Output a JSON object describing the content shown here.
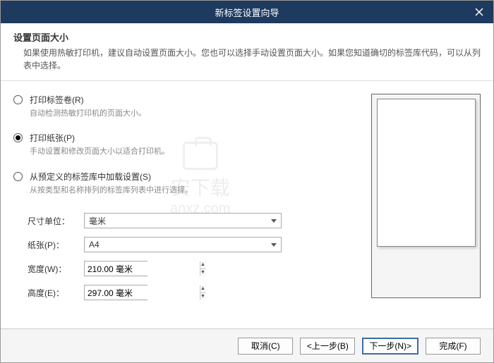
{
  "title": "新标签设置向导",
  "header": {
    "title": "设置页面大小",
    "desc": "如果使用热敏打印机，建议自动设置页面大小。您也可以选择手动设置页面大小。如果您知道确切的标签库代码，可以从列表中选择。"
  },
  "options": {
    "roll": {
      "label": "打印标签卷(R)",
      "desc": "自动检测热敏打印机的页面大小。"
    },
    "paper": {
      "label": "打印纸张(P)",
      "desc": "手动设置和修改页面大小以适合打印机。"
    },
    "predef": {
      "label": "从预定义的标签库中加载设置(S)",
      "desc": "从按类型和名称排列的标签库列表中进行选择。"
    }
  },
  "fields": {
    "unit_label": "尺寸单位：",
    "unit_value": "毫米",
    "paper_label": "纸张(P)：",
    "paper_value": "A4",
    "width_label": "宽度(W)：",
    "width_value": "210.00 毫米",
    "height_label": "高度(E)：",
    "height_value": "297.00 毫米"
  },
  "buttons": {
    "cancel": "取消(C)",
    "back": "<上一步(B)",
    "next": "下一步(N)>",
    "finish": "完成(F)"
  },
  "watermark": {
    "text1": "安下载",
    "text2": "anxz.com"
  }
}
